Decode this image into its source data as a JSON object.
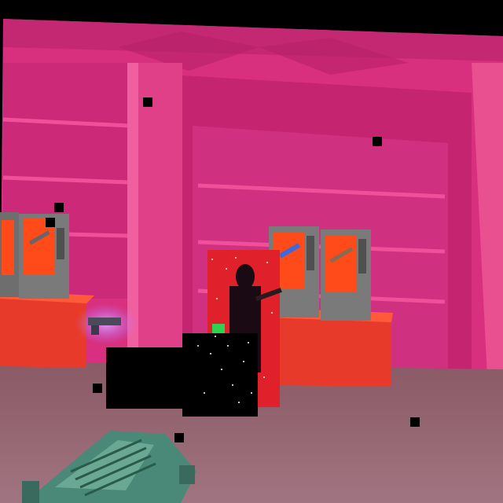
{
  "scene": {
    "description_type": "first-person-shooter viewport",
    "palette": {
      "wall": "#d8307e",
      "wall_dark": "#b8206a",
      "shelf_line": "#f0509a",
      "counter": "#e83a2a",
      "counter_top": "#ff5a3a",
      "floor": "#9e6a78",
      "vending_body": "#6e6e6e",
      "vending_screen": "#ff4a1a",
      "enemy_glitch": "#e0202a",
      "weapon": "#5a9a8a"
    },
    "objects": {
      "vending_machines": [
        {
          "name": "vending-machine-left-1",
          "item_icon": "rifle-icon"
        },
        {
          "name": "vending-machine-left-2",
          "item_icon": "rifle-icon"
        },
        {
          "name": "vending-machine-right-1",
          "item_icon": "smg-icon"
        },
        {
          "name": "vending-machine-right-2",
          "item_icon": "shotgun-icon"
        }
      ],
      "floor_pickup": {
        "name": "pickup-weapon",
        "icon": "weapon-pickup-icon",
        "glow": "#b070ff"
      },
      "enemy": {
        "name": "enemy-character",
        "state": "glitched"
      },
      "held_weapon": {
        "name": "held-weapon",
        "icon": "assault-rifle-icon"
      }
    }
  }
}
